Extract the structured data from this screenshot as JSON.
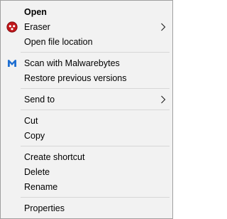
{
  "menu": {
    "items": [
      {
        "label": "Open",
        "bold": true
      },
      {
        "label": "Eraser",
        "icon": "eraser-icon",
        "submenu": true
      },
      {
        "label": "Open file location"
      },
      {
        "label": "Scan with Malwarebytes",
        "icon": "malwarebytes-icon"
      },
      {
        "label": "Restore previous versions"
      },
      {
        "label": "Send to",
        "submenu": true
      },
      {
        "label": "Cut"
      },
      {
        "label": "Copy"
      },
      {
        "label": "Create shortcut"
      },
      {
        "label": "Delete"
      },
      {
        "label": "Rename"
      },
      {
        "label": "Properties"
      }
    ]
  },
  "colors": {
    "menu_background": "#f2f2f2",
    "separator": "#d7d7d7",
    "eraser_icon": "#c0161a",
    "malwarebytes_icon": "#1f6fd1"
  }
}
